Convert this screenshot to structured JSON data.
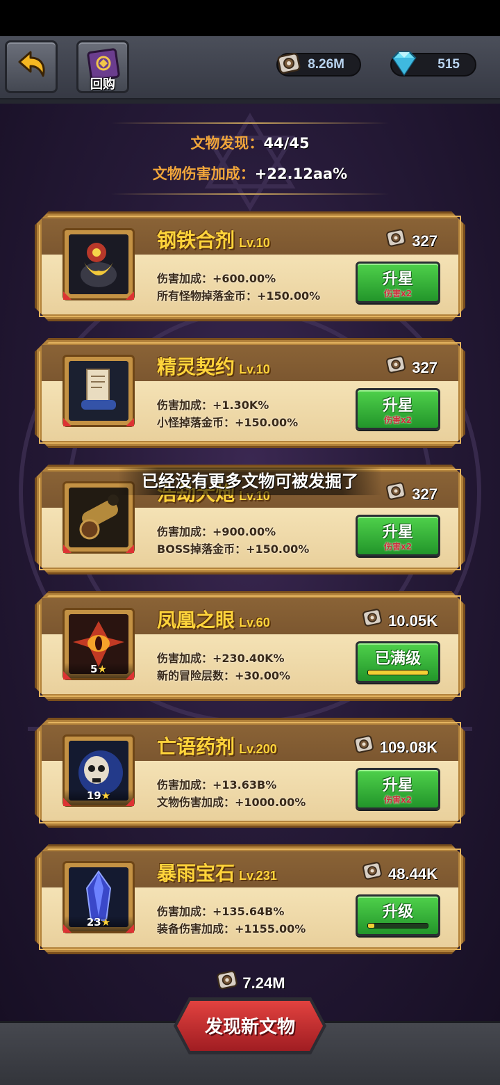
{
  "header": {
    "buyback_label": "回购",
    "gears": "8.26M",
    "gems": "515"
  },
  "stats": {
    "found_label": "文物发现：",
    "found_value": "44/45",
    "bonus_label": "文物伤害加成：",
    "bonus_value": "+22.12aa%"
  },
  "artifacts": [
    {
      "name": "钢铁合剂",
      "level": "Lv.10",
      "cost": "327",
      "stars": "",
      "effect1": "伤害加成：+600.00%",
      "effect2": "所有怪物掉落金币：+150.00%",
      "button_label": "升星",
      "button_sub": "伤害x2",
      "progress": null,
      "icon": "iron-potion-icon"
    },
    {
      "name": "精灵契约",
      "level": "Lv.10",
      "cost": "327",
      "stars": "",
      "effect1": "伤害加成：+1.30K%",
      "effect2": "小怪掉落金币：+150.00%",
      "button_label": "升星",
      "button_sub": "伤害x2",
      "progress": null,
      "icon": "scroll-icon"
    },
    {
      "name": "浩劫大炮",
      "level": "Lv.10",
      "cost": "327",
      "stars": "",
      "effect1": "伤害加成：+900.00%",
      "effect2": "BOSS掉落金币：+150.00%",
      "button_label": "升星",
      "button_sub": "伤害x2",
      "progress": null,
      "icon": "cannon-icon"
    },
    {
      "name": "凤凰之眼",
      "level": "Lv.60",
      "cost": "10.05K",
      "stars": "5",
      "effect1": "伤害加成：+230.40K%",
      "effect2": "新的冒险层数：+30.00%",
      "button_label": "已满级",
      "button_sub": "",
      "progress": 1.0,
      "icon": "phoenix-eye-icon"
    },
    {
      "name": "亡语药剂",
      "level": "Lv.200",
      "cost": "109.08K",
      "stars": "19",
      "effect1": "伤害加成：+13.63B%",
      "effect2": "文物伤害加成：+1000.00%",
      "button_label": "升星",
      "button_sub": "伤害x2",
      "progress": null,
      "icon": "skull-potion-icon"
    },
    {
      "name": "暴雨宝石",
      "level": "Lv.231",
      "cost": "48.44K",
      "stars": "23",
      "effect1": "伤害加成：+135.64B%",
      "effect2": "装备伤害加成：+1155.00%",
      "button_label": "升级",
      "button_sub": "",
      "progress": 0.1,
      "icon": "crystal-icon"
    }
  ],
  "toast": "已经没有更多文物可被发掘了",
  "discover": {
    "cost": "7.24M",
    "label": "发现新文物"
  },
  "colors": {
    "title_gold": "#ffd43b",
    "stat_orange": "#f0a53a",
    "button_green": "#3bbf3d",
    "discover_red": "#c8302f",
    "card_frame": "#b2823b"
  }
}
